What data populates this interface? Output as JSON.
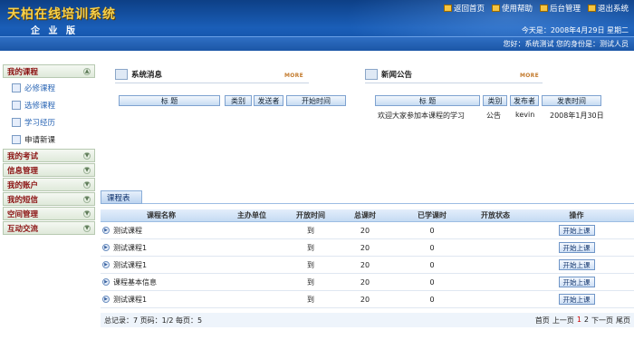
{
  "header": {
    "logo": "天柏在线培训系统",
    "edition": "企 业 版",
    "nav": [
      {
        "label": "返回首页",
        "icon": "home-icon"
      },
      {
        "label": "使用帮助",
        "icon": "help-icon"
      },
      {
        "label": "后台管理",
        "icon": "admin-icon"
      },
      {
        "label": "退出系统",
        "icon": "logout-icon"
      }
    ],
    "date": "今天是：2008年4月29日 星期二",
    "user_info": "您好：系统测试    您的身份是：测试人员"
  },
  "sidebar": {
    "categories": [
      {
        "label": "我的课程"
      },
      {
        "label": "我的考试"
      },
      {
        "label": "信息管理"
      },
      {
        "label": "我的账户"
      },
      {
        "label": "我的短信"
      },
      {
        "label": "空间管理"
      },
      {
        "label": "互动交流"
      }
    ],
    "course_items": [
      {
        "label": "必修课程"
      },
      {
        "label": "选修课程"
      },
      {
        "label": "学习经历"
      },
      {
        "label": "申请新课"
      }
    ]
  },
  "messages": {
    "title": "系统消息",
    "more": "MORE",
    "headers": [
      "标  题",
      "类别",
      "发送者",
      "开始时间"
    ]
  },
  "news": {
    "title": "新闻公告",
    "more": "MORE",
    "headers": [
      "标  题",
      "类别",
      "发布者",
      "发表时间"
    ],
    "row": {
      "title": "欢迎大家参加本课程的学习",
      "type": "公告",
      "author": "kevin",
      "date": "2008年1月30日"
    }
  },
  "course_table": {
    "tab": "课程表",
    "headers": [
      "课程名称",
      "主办单位",
      "开放时间",
      "总课时",
      "已学课时",
      "开放状态",
      "操作"
    ],
    "rows": [
      {
        "name": "测试课程",
        "open": "到",
        "total": "20",
        "learned": "0",
        "action": "开始上课"
      },
      {
        "name": "测试课程1",
        "open": "到",
        "total": "20",
        "learned": "0",
        "action": "开始上课"
      },
      {
        "name": "测试课程1",
        "open": "到",
        "total": "20",
        "learned": "0",
        "action": "开始上课"
      },
      {
        "name": "课程基本信息",
        "open": "到",
        "total": "20",
        "learned": "0",
        "action": "开始上课"
      },
      {
        "name": "测试课程1",
        "open": "到",
        "total": "20",
        "learned": "0",
        "action": "开始上课"
      }
    ],
    "summary": "总记录：7 页码：1/2 每页：5",
    "pager": {
      "first": "首页",
      "prev": "上一页",
      "p1": "1",
      "p2": "2",
      "next": "下一页",
      "last": "尾页"
    }
  }
}
